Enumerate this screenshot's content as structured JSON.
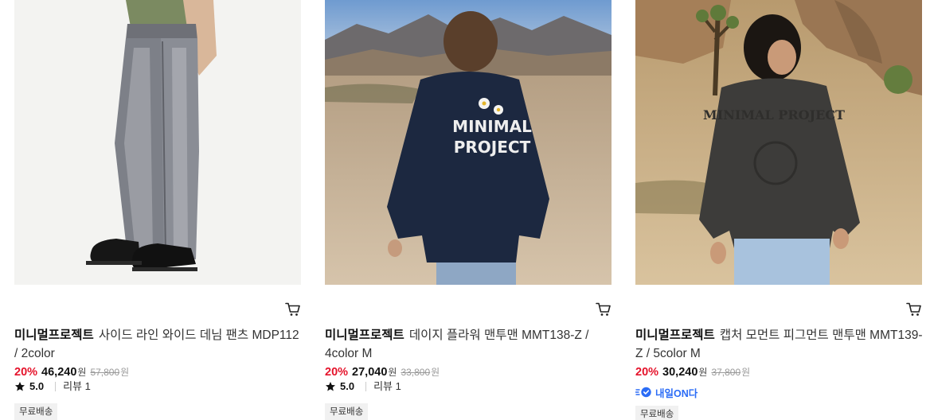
{
  "products": [
    {
      "image_alt": "",
      "brand": "미니멀프로젝트",
      "name": "사이드 라인 와이드 데님 팬츠 MDP112 / 2color",
      "discount": "20%",
      "price": "46,240",
      "price_unit": "원",
      "original_price": "57,800",
      "original_unit": "원",
      "rating": "5.0",
      "reviews": "리뷰 1",
      "shipping_tag": "무료배송"
    },
    {
      "image_alt": "",
      "brand": "미니멀프로젝트",
      "name": "데이지 플라워 맨투맨 MMT138-Z / 4color M",
      "discount": "20%",
      "price": "27,040",
      "price_unit": "원",
      "original_price": "33,800",
      "original_unit": "원",
      "rating": "5.0",
      "reviews": "리뷰 1",
      "shipping_tag": "무료배송"
    },
    {
      "image_alt": "",
      "brand": "미니멀프로젝트",
      "name": "캡처 모먼트 피그먼트 맨투맨 MMT139-Z / 5color M",
      "discount": "20%",
      "price": "30,240",
      "price_unit": "원",
      "original_price": "37,800",
      "original_unit": "원",
      "delivery_badge": "내일ON다",
      "shipping_tag": "무료배송"
    }
  ],
  "graphics": {
    "sweatshirt_print": "MINIMAL PROJECT",
    "colors": {
      "discount_red": "#e5132b",
      "badge_blue": "#2b6cf6",
      "tag_bg": "#f1f1f1"
    }
  },
  "icons": [
    "cart-icon",
    "star-icon",
    "delivery-icon"
  ]
}
